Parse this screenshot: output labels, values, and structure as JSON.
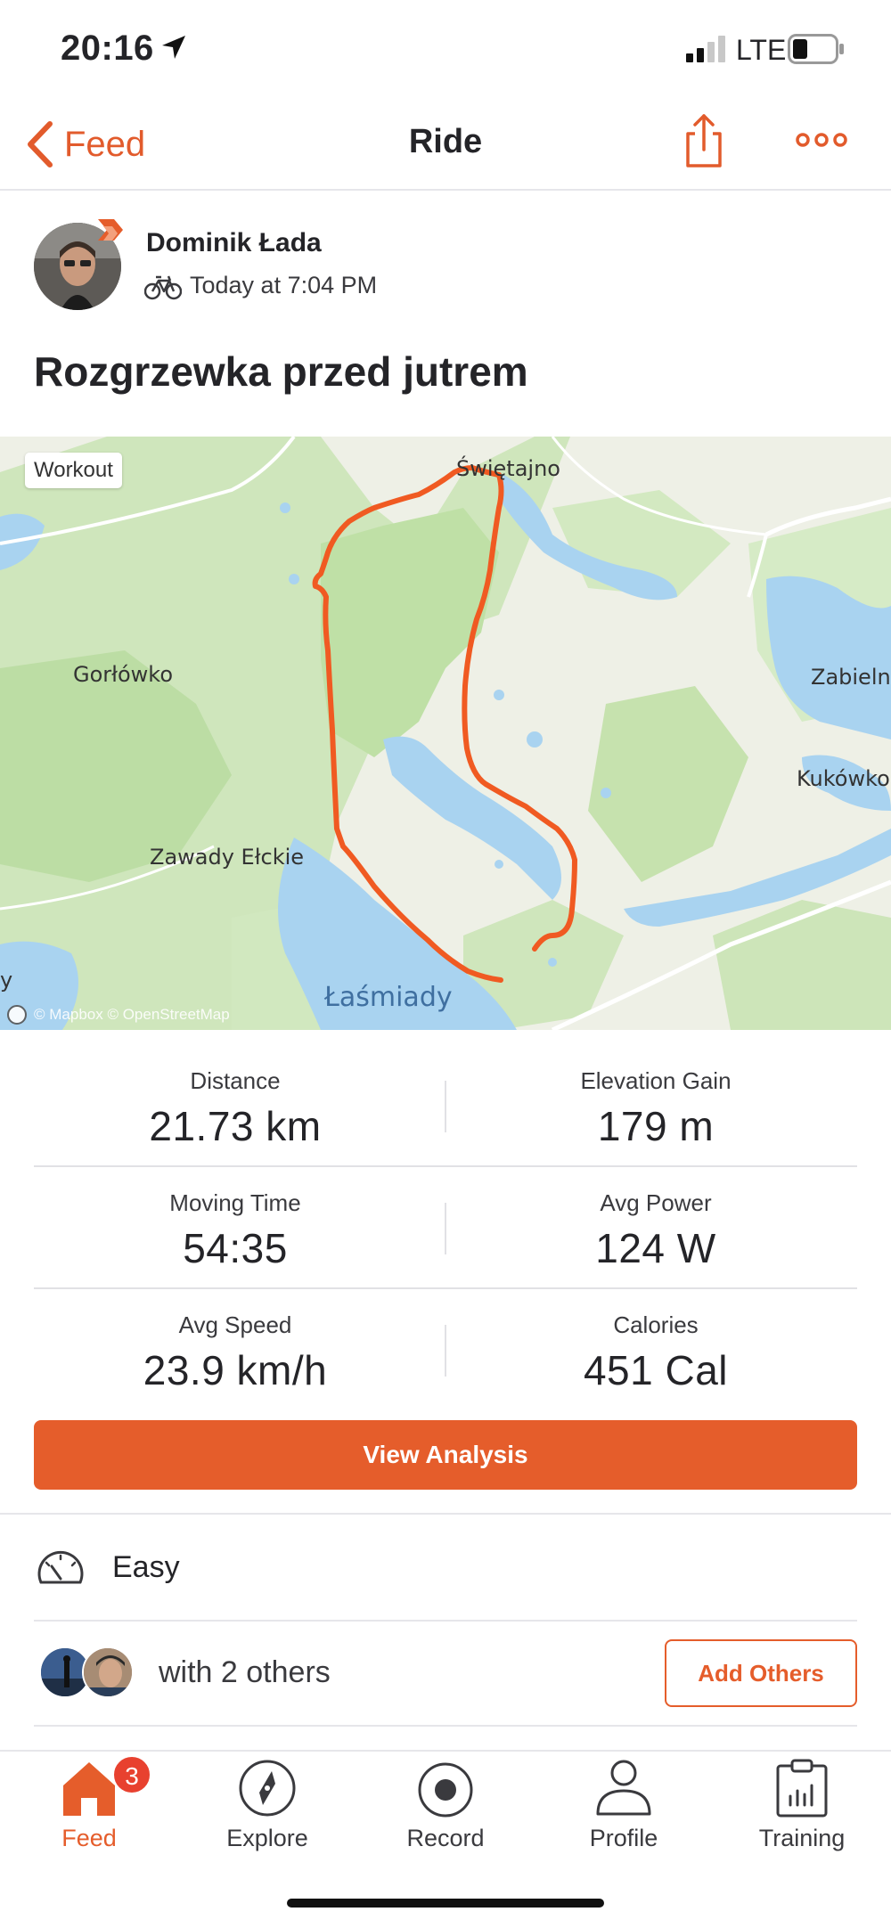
{
  "status_bar": {
    "time": "20:16",
    "network": "LTE"
  },
  "nav": {
    "back_label": "Feed",
    "title": "Ride"
  },
  "activity": {
    "athlete": "Dominik Łada",
    "timestamp": "Today at 7:04 PM",
    "title": "Rozgrzewka przed jutrem"
  },
  "map": {
    "tag": "Workout",
    "labels": [
      "Świętajno",
      "Gorłówko",
      "Zabielne",
      "Kukówko",
      "Zawady Ełckie",
      "Łaśmiady",
      "y"
    ],
    "attribution": "© Mapbox © OpenStreetMap"
  },
  "stats": [
    {
      "label": "Distance",
      "value": "21.73 km"
    },
    {
      "label": "Elevation Gain",
      "value": "179 m"
    },
    {
      "label": "Moving Time",
      "value": "54:35"
    },
    {
      "label": "Avg Power",
      "value": "124 W"
    },
    {
      "label": "Avg Speed",
      "value": "23.9 km/h"
    },
    {
      "label": "Calories",
      "value": "451 Cal"
    }
  ],
  "actions": {
    "view_analysis": "View Analysis",
    "add_others": "Add Others"
  },
  "perceived_effort": "Easy",
  "group": {
    "with_others": "with 2 others"
  },
  "tabs": [
    {
      "label": "Feed",
      "badge": "3",
      "active": true
    },
    {
      "label": "Explore"
    },
    {
      "label": "Record"
    },
    {
      "label": "Profile"
    },
    {
      "label": "Training"
    }
  ],
  "colors": {
    "accent": "#e55d2b",
    "route": "#f05a22",
    "badge": "#e8412f"
  }
}
